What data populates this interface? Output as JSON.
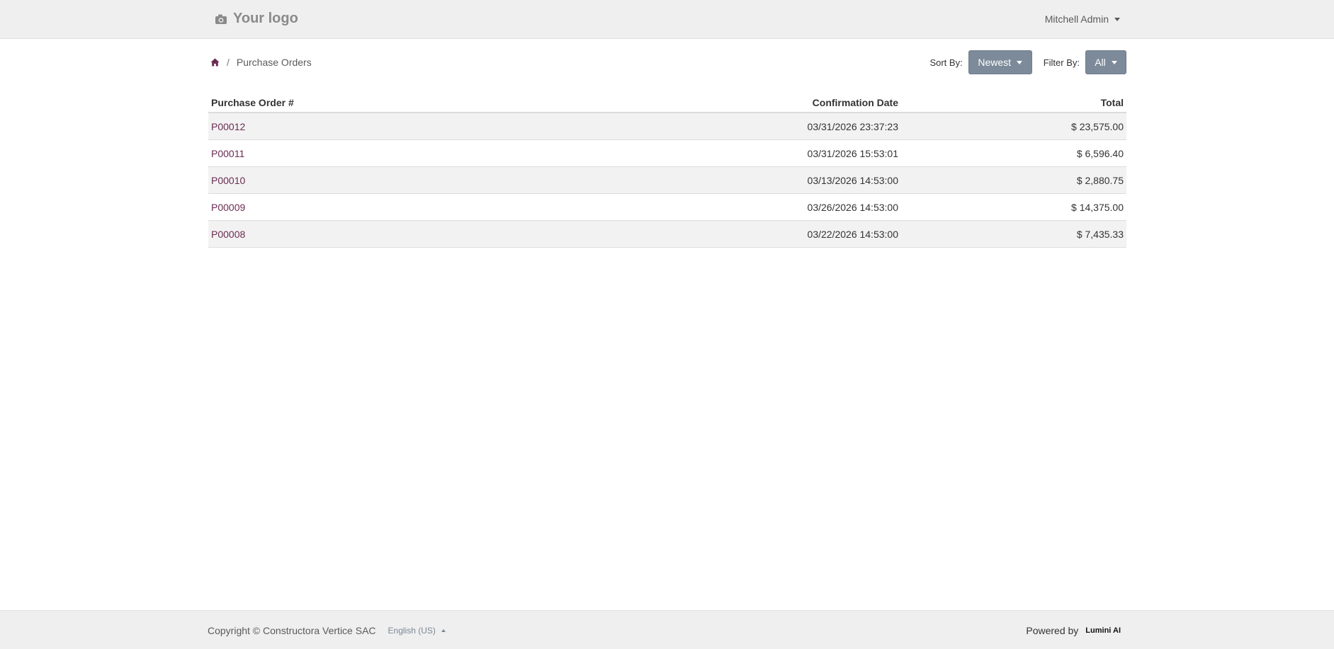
{
  "header": {
    "logo_text": "Your logo",
    "user_name": "Mitchell Admin"
  },
  "breadcrumb": {
    "current": "Purchase Orders"
  },
  "controls": {
    "sort_label": "Sort By:",
    "sort_value": "Newest",
    "filter_label": "Filter By:",
    "filter_value": "All"
  },
  "table": {
    "columns": [
      "Purchase Order #",
      "Confirmation Date",
      "Total"
    ],
    "rows": [
      {
        "po": "P00012",
        "date": "03/31/2026  23:37:23",
        "total": "$ 23,575.00"
      },
      {
        "po": "P00011",
        "date": "03/31/2026  15:53:01",
        "total": "$ 6,596.40"
      },
      {
        "po": "P00010",
        "date": "03/13/2026  14:53:00",
        "total": "$ 2,880.75"
      },
      {
        "po": "P00009",
        "date": "03/26/2026  14:53:00",
        "total": "$ 14,375.00"
      },
      {
        "po": "P00008",
        "date": "03/22/2026  14:53:00",
        "total": "$ 7,435.33"
      }
    ]
  },
  "footer": {
    "copyright": "Copyright © Constructora Vertice SAC",
    "language": "English (US)",
    "powered_by": "Powered by",
    "brand": "Lumini AI"
  },
  "colors": {
    "link": "#6a2c52",
    "button": "#7c8a99",
    "header_bg": "#efefef"
  }
}
